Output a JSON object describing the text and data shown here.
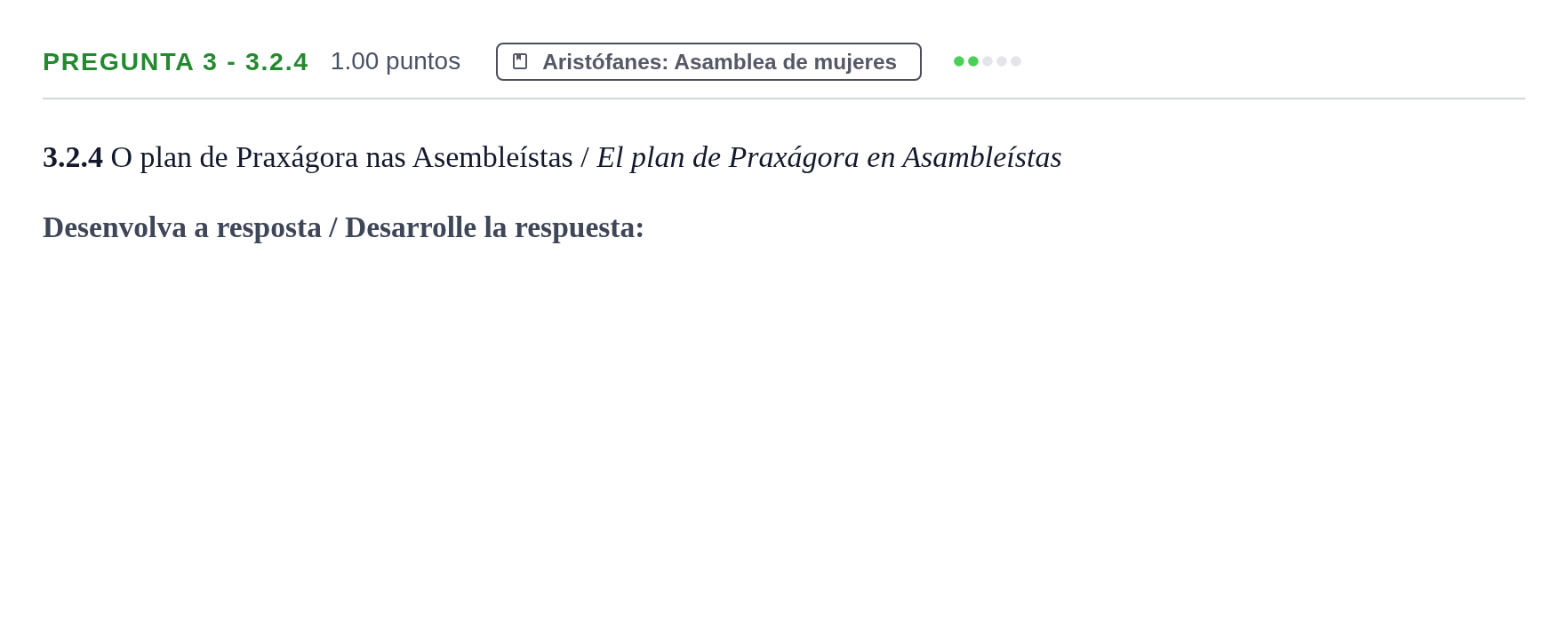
{
  "question": {
    "title": "PREGUNTA 3 - 3.2.4",
    "points": "1.00 puntos",
    "topic": "Aristófanes: Asamblea de mujeres",
    "stars": 2
  },
  "prompt": {
    "heading": "**3.2.4** O plan de Praxágora nas Asembleístas / *El plan de Praxágora en Asambleístas*",
    "instruction": "Desenvolva a resposta / Desarrolle la respuesta:"
  }
}
